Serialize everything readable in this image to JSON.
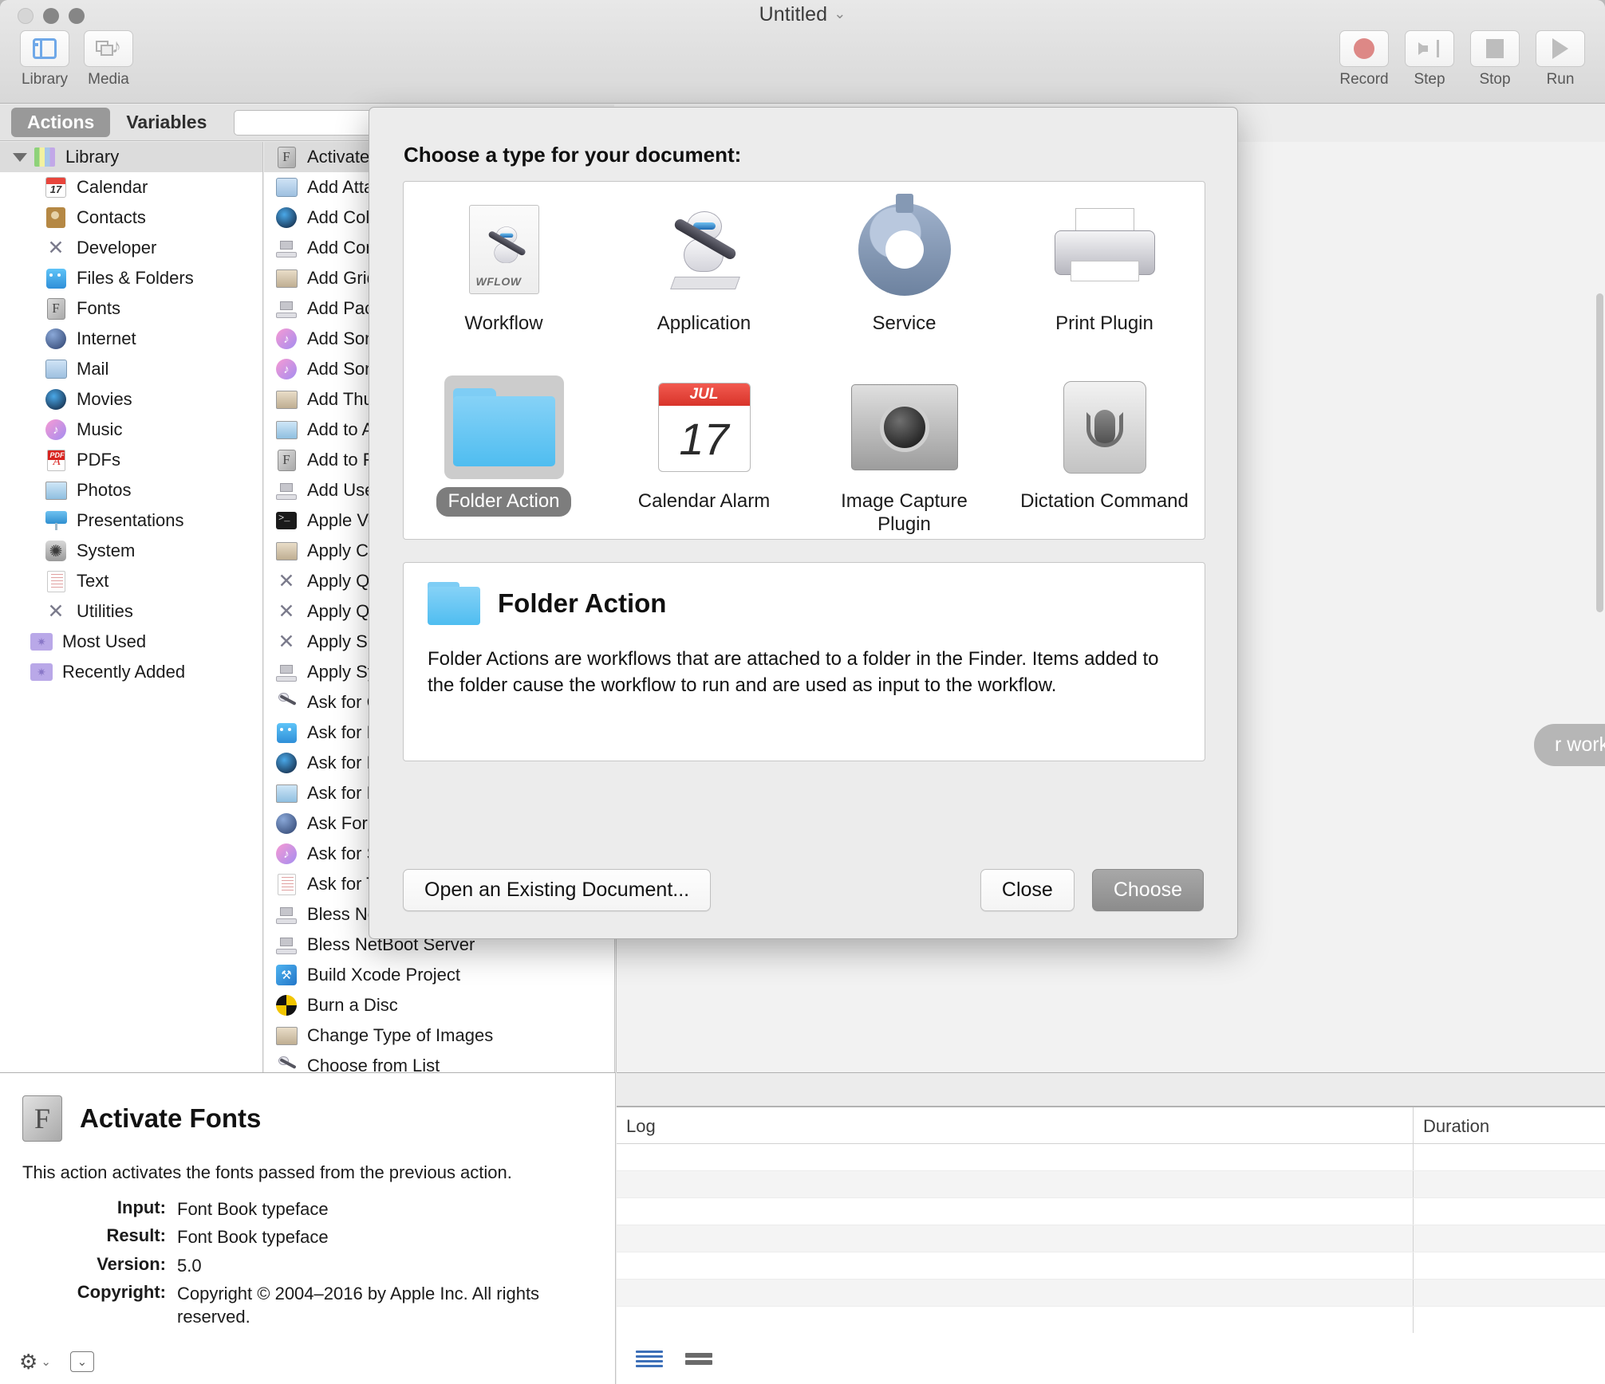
{
  "window": {
    "title": "Untitled",
    "title_chevron": "⌄"
  },
  "toolbar": {
    "left_items": [
      {
        "label": "Library",
        "icon": "library-icon"
      },
      {
        "label": "Media",
        "icon": "media-icon"
      }
    ],
    "right_items": [
      {
        "label": "Record",
        "icon": "record-icon"
      },
      {
        "label": "Step",
        "icon": "step-icon"
      },
      {
        "label": "Stop",
        "icon": "stop-icon"
      },
      {
        "label": "Run",
        "icon": "run-icon"
      }
    ]
  },
  "tabs": {
    "actions": "Actions",
    "variables": "Variables",
    "search_placeholder": ""
  },
  "sidebar": {
    "root": {
      "label": "Library",
      "icon": "books-icon"
    },
    "items": [
      {
        "label": "Calendar",
        "icon": "calendar-icon"
      },
      {
        "label": "Contacts",
        "icon": "contacts-icon"
      },
      {
        "label": "Developer",
        "icon": "tools-icon"
      },
      {
        "label": "Files & Folders",
        "icon": "finder-icon"
      },
      {
        "label": "Fonts",
        "icon": "fontbook-icon"
      },
      {
        "label": "Internet",
        "icon": "globe-icon"
      },
      {
        "label": "Mail",
        "icon": "mail-icon"
      },
      {
        "label": "Movies",
        "icon": "quicktime-icon"
      },
      {
        "label": "Music",
        "icon": "itunes-icon"
      },
      {
        "label": "PDFs",
        "icon": "pdf-icon"
      },
      {
        "label": "Photos",
        "icon": "photos-icon"
      },
      {
        "label": "Presentations",
        "icon": "keynote-icon"
      },
      {
        "label": "System",
        "icon": "system-icon"
      },
      {
        "label": "Text",
        "icon": "textedit-icon"
      },
      {
        "label": "Utilities",
        "icon": "tools-icon"
      }
    ],
    "smart_groups": [
      {
        "label": "Most Used",
        "icon": "smart-folder-icon"
      },
      {
        "label": "Recently Added",
        "icon": "smart-folder-icon"
      }
    ]
  },
  "actions_list": {
    "selected": "Activate Fonts",
    "items": [
      {
        "label": "Activate Fonts",
        "icon": "fontbook-icon",
        "selected": true
      },
      {
        "label": "Add Attachments to Front Message",
        "icon": "mail-icon",
        "selected": false
      },
      {
        "label": "Add Color Profile",
        "icon": "quicktime-icon",
        "selected": false
      },
      {
        "label": "Add Computers",
        "icon": "server-icon",
        "selected": false
      },
      {
        "label": "Add Grid to Photos",
        "icon": "photoedit-icon",
        "selected": false
      },
      {
        "label": "Add Packages to Deploy Studio",
        "icon": "server-icon",
        "selected": false
      },
      {
        "label": "Add Songs to iTunes",
        "icon": "itunes-icon",
        "selected": false
      },
      {
        "label": "Add Songs to Playlist",
        "icon": "itunes-icon",
        "selected": false
      },
      {
        "label": "Add Thumbnail to Image",
        "icon": "photoedit-icon",
        "selected": false
      },
      {
        "label": "Add to Albums",
        "icon": "photos-icon",
        "selected": false
      },
      {
        "label": "Add to Font Library",
        "icon": "fontbook-icon",
        "selected": false
      },
      {
        "label": "Add Users",
        "icon": "server-icon",
        "selected": false
      },
      {
        "label": "Apple Voice",
        "icon": "terminal-icon",
        "selected": false
      },
      {
        "label": "Apply ColorSync Profile to Images",
        "icon": "photoedit-icon",
        "selected": false
      },
      {
        "label": "Apply Quartz Composition Filter",
        "icon": "tools-icon",
        "selected": false
      },
      {
        "label": "Apply Quartz Filter to PDF",
        "icon": "tools-icon",
        "selected": false
      },
      {
        "label": "Apply SQL",
        "icon": "tools-icon",
        "selected": false
      },
      {
        "label": "Apply System Image",
        "icon": "server-icon",
        "selected": false
      },
      {
        "label": "Ask for Confirmation",
        "icon": "robot-icon",
        "selected": false
      },
      {
        "label": "Ask for Finder Items",
        "icon": "finder-icon",
        "selected": false
      },
      {
        "label": "Ask for Movies",
        "icon": "quicktime-icon",
        "selected": false
      },
      {
        "label": "Ask for Photos",
        "icon": "photos-icon",
        "selected": false
      },
      {
        "label": "Ask For Servers",
        "icon": "globe-icon",
        "selected": false
      },
      {
        "label": "Ask for Songs",
        "icon": "itunes-icon",
        "selected": false
      },
      {
        "label": "Ask for Text",
        "icon": "textedit-icon",
        "selected": false
      },
      {
        "label": "Bless NetBoot Server",
        "icon": "server-icon",
        "selected": false
      },
      {
        "label": "Bless NetBoot Server",
        "icon": "server-icon",
        "selected": false
      },
      {
        "label": "Build Xcode Project",
        "icon": "xcode-icon",
        "selected": false
      },
      {
        "label": "Burn a Disc",
        "icon": "burn-icon",
        "selected": false
      },
      {
        "label": "Change Type of Images",
        "icon": "photoedit-icon",
        "selected": false
      },
      {
        "label": "Choose from List",
        "icon": "robot-icon",
        "selected": false
      }
    ]
  },
  "canvas": {
    "hint": "r workflow."
  },
  "dialog": {
    "prompt": "Choose a type for your document:",
    "types": [
      {
        "label": "Workflow",
        "icon": "workflow-doc-icon",
        "selected": false,
        "badge": "WFLOW"
      },
      {
        "label": "Application",
        "icon": "automator-robot-icon",
        "selected": false
      },
      {
        "label": "Service",
        "icon": "gear-icon",
        "selected": false
      },
      {
        "label": "Print Plugin",
        "icon": "printer-icon",
        "selected": false
      },
      {
        "label": "Folder Action",
        "icon": "folder-icon",
        "selected": true
      },
      {
        "label": "Calendar Alarm",
        "icon": "calendar-icon",
        "selected": false,
        "month": "JUL",
        "day": "17"
      },
      {
        "label": "Image Capture Plugin",
        "icon": "camera-icon",
        "selected": false
      },
      {
        "label": "Dictation Command",
        "icon": "microphone-icon",
        "selected": false
      }
    ],
    "detail": {
      "title": "Folder Action",
      "icon": "folder-icon",
      "description": "Folder Actions are workflows that are attached to a folder in the Finder. Items added to the folder cause the workflow to run and are used as input to the workflow."
    },
    "buttons": {
      "open_existing": "Open an Existing Document...",
      "close": "Close",
      "choose": "Choose"
    }
  },
  "info_panel": {
    "title": "Activate Fonts",
    "icon": "fontbook-icon",
    "description": "This action activates the fonts passed from the previous action.",
    "fields": [
      {
        "key": "Input:",
        "value": "Font Book typeface"
      },
      {
        "key": "Result:",
        "value": "Font Book typeface"
      },
      {
        "key": "Version:",
        "value": "5.0"
      },
      {
        "key": "Copyright:",
        "value": "Copyright © 2004–2016 by Apple Inc. All rights reserved."
      }
    ],
    "gear_menu": "⚙",
    "gear_chevron": "⌄",
    "toggle_icon": "⌄"
  },
  "log_panel": {
    "columns": {
      "log": "Log",
      "duration": "Duration"
    },
    "rows": [],
    "footer_buttons": [
      {
        "icon": "list-view-icon"
      },
      {
        "icon": "split-view-icon"
      }
    ]
  },
  "colors": {
    "accent": "#6fa8e8",
    "selection": "#7d7d7d",
    "folder_blue": "#4fbdf0",
    "record_red": "#dd8886"
  }
}
